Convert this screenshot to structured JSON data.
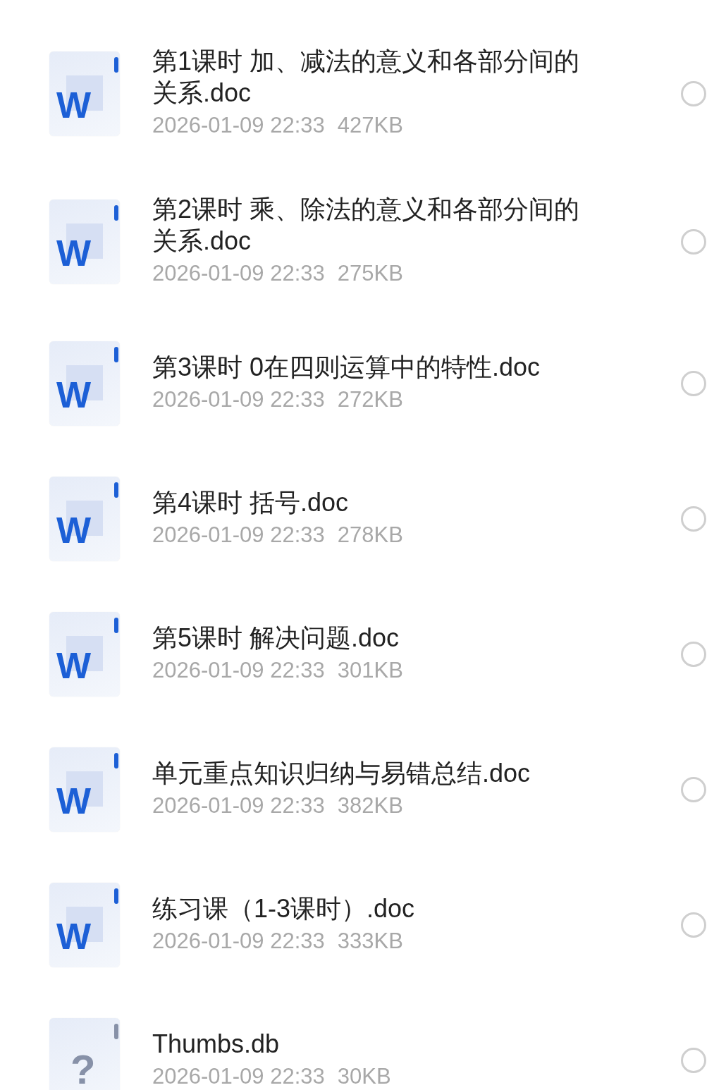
{
  "files": [
    {
      "name": "第1课时 加、减法的意义和各部分间的关系.doc",
      "date": "2026-01-09 22:33",
      "size": "427KB",
      "kind": "word",
      "icon_letter": "W",
      "selected": false
    },
    {
      "name": "第2课时 乘、除法的意义和各部分间的关系.doc",
      "date": "2026-01-09 22:33",
      "size": "275KB",
      "kind": "word",
      "icon_letter": "W",
      "selected": false
    },
    {
      "name": "第3课时 0在四则运算中的特性.doc",
      "date": "2026-01-09 22:33",
      "size": "272KB",
      "kind": "word",
      "icon_letter": "W",
      "selected": false
    },
    {
      "name": "第4课时 括号.doc",
      "date": "2026-01-09 22:33",
      "size": "278KB",
      "kind": "word",
      "icon_letter": "W",
      "selected": false
    },
    {
      "name": "第5课时 解决问题.doc",
      "date": "2026-01-09 22:33",
      "size": "301KB",
      "kind": "word",
      "icon_letter": "W",
      "selected": false
    },
    {
      "name": "单元重点知识归纳与易错总结.doc",
      "date": "2026-01-09 22:33",
      "size": "382KB",
      "kind": "word",
      "icon_letter": "W",
      "selected": false
    },
    {
      "name": "练习课（1-3课时）.doc",
      "date": "2026-01-09 22:33",
      "size": "333KB",
      "kind": "word",
      "icon_letter": "W",
      "selected": false
    },
    {
      "name": "Thumbs.db",
      "date": "2026-01-09 22:33",
      "size": "30KB",
      "kind": "unknown",
      "icon_letter": "?",
      "selected": false
    }
  ]
}
